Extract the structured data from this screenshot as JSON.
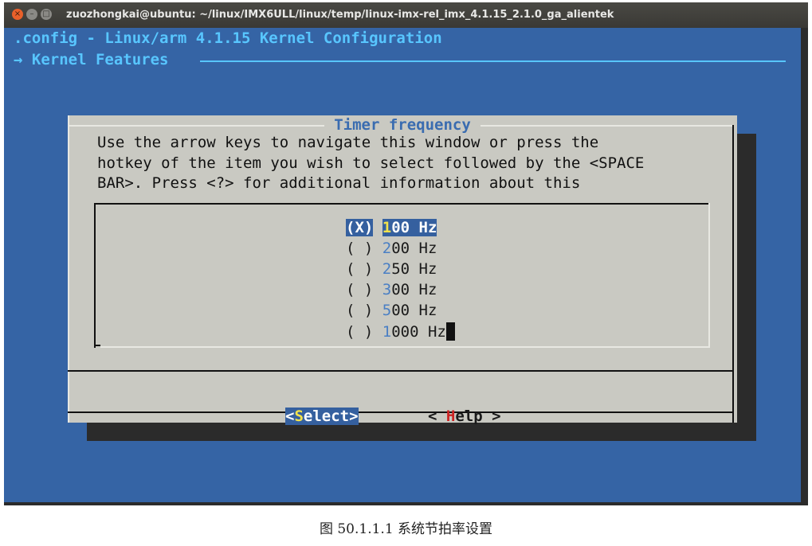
{
  "window": {
    "title": "zuozhongkai@ubuntu: ~/linux/IMX6ULL/linux/temp/linux-imx-rel_imx_4.1.15_2.1.0_ga_alientek",
    "controls": {
      "close": "×",
      "minimize": "–",
      "maximize": "□"
    }
  },
  "menuconfig": {
    "header": ".config - Linux/arm 4.1.15 Kernel Configuration",
    "breadcrumb": "→ Kernel Features",
    "dialog": {
      "title": "Timer frequency",
      "help_text": "Use the arrow keys to navigate this window or press the\nhotkey of the item you wish to select followed by the <SPACE\nBAR>. Press <?> for additional information about this",
      "options": [
        {
          "mark": "(X)",
          "hotkey": "1",
          "rest": "00 Hz",
          "selected": true
        },
        {
          "mark": "( )",
          "hotkey": "2",
          "rest": "00 Hz",
          "selected": false
        },
        {
          "mark": "( )",
          "hotkey": "2",
          "rest": "50 Hz",
          "selected": false
        },
        {
          "mark": "( )",
          "hotkey": "3",
          "rest": "00 Hz",
          "selected": false
        },
        {
          "mark": "( )",
          "hotkey": "5",
          "rest": "00 Hz",
          "selected": false
        },
        {
          "mark": "( )",
          "hotkey": "1",
          "rest": "000 Hz",
          "selected": false
        }
      ],
      "buttons": {
        "select": {
          "open": "<",
          "hotkey": "S",
          "rest": "elect",
          "close": ">"
        },
        "help": {
          "open": "< ",
          "hotkey": "H",
          "rest": "elp",
          "close": " >"
        }
      }
    }
  },
  "caption": "图 50.1.1.1 系统节拍率设置",
  "colors": {
    "screen_bg": "#3564a5",
    "header_text": "#58c6ff",
    "dialog_bg": "#c9c9c2",
    "highlight_bg": "#35609f",
    "hotkey_selected": "#f2e24b",
    "hotkey_help": "#cc2222",
    "close_button": "#e9602a"
  }
}
